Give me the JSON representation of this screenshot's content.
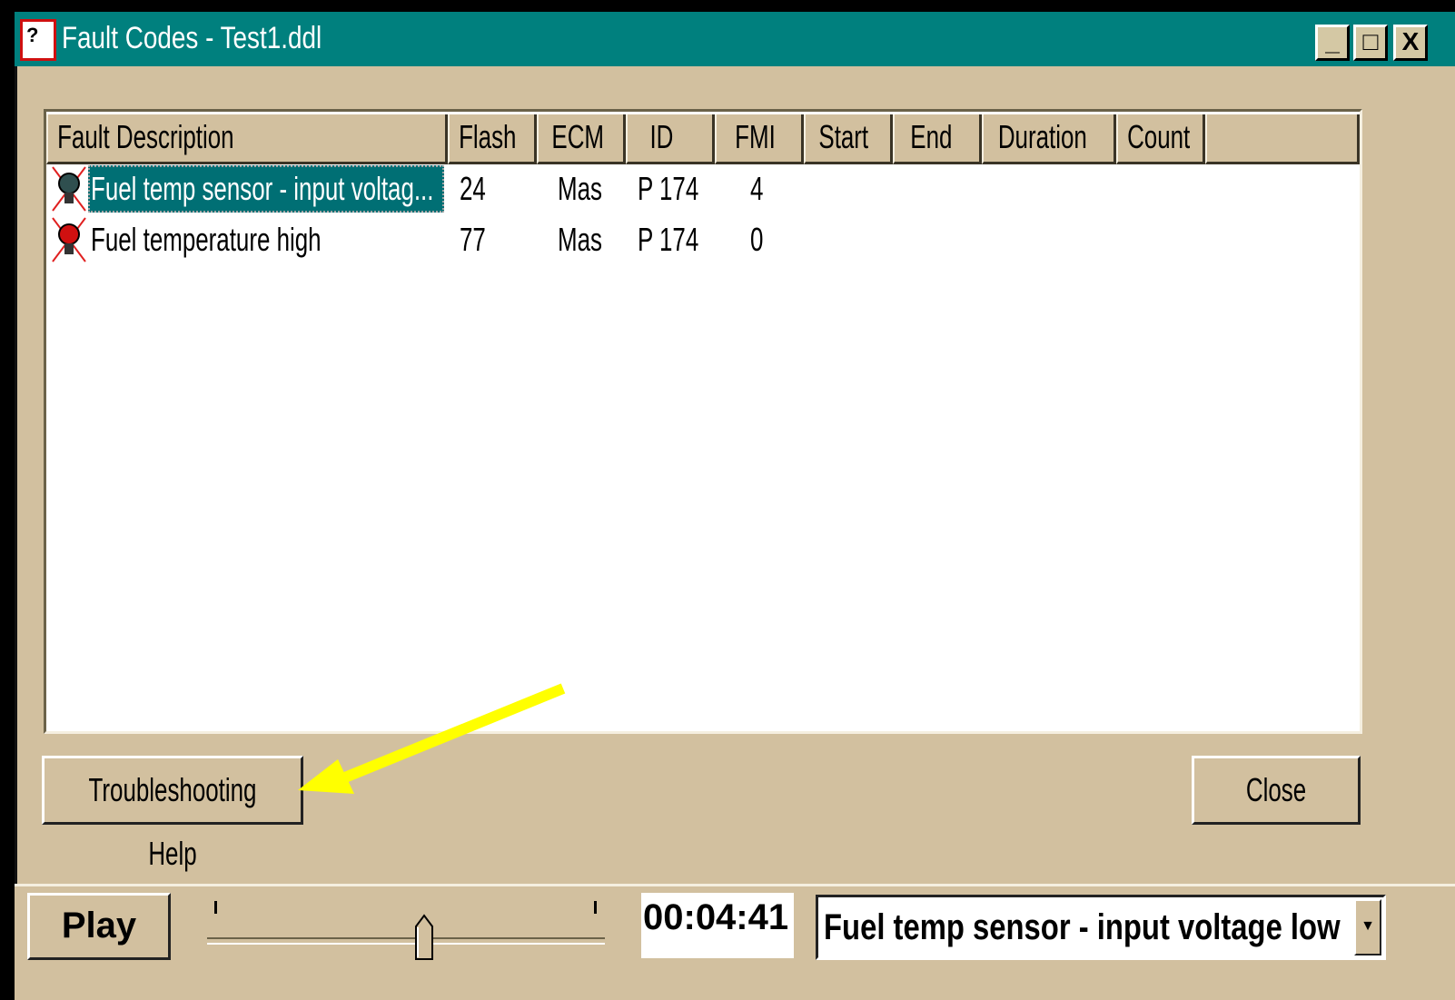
{
  "window": {
    "title": "Fault Codes - Test1.ddl",
    "buttons": {
      "minimize": "_",
      "maximize": "□",
      "close": "X"
    }
  },
  "table": {
    "columns": [
      "Fault Description",
      "Flash",
      "ECM",
      "ID",
      "FMI",
      "Start",
      "End",
      "Duration",
      "Count"
    ],
    "rows": [
      {
        "description": "Fuel temp sensor - input voltag...",
        "flash": "24",
        "ecm": "Mas",
        "id": "P 174",
        "fmi": "4",
        "icon": "fault-lamp-icon",
        "selected": true
      },
      {
        "description": "Fuel temperature high",
        "flash": "77",
        "ecm": "Mas",
        "id": "P 174",
        "fmi": "0",
        "icon": "fault-lamp-red-icon",
        "selected": false
      }
    ]
  },
  "buttons": {
    "troubleshooting": "Troubleshooting Help",
    "close": "Close"
  },
  "player": {
    "play": "Play",
    "time": "00:04:41",
    "slider_position": 0.55,
    "selected_fault": "Fuel temp sensor - input voltage low"
  },
  "colors": {
    "titlebar": "#00807e",
    "face": "#d2c09f",
    "selection": "#006f74",
    "arrow": "#ffff00"
  }
}
